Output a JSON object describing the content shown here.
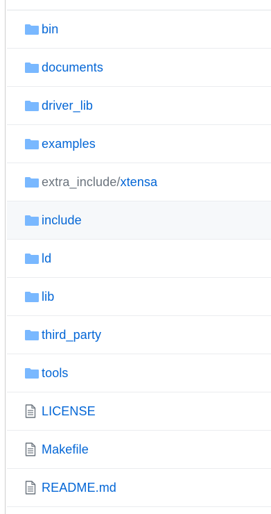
{
  "colors": {
    "link": "#0366d6",
    "folder_icon": "#79b8ff",
    "file_icon": "#6a737d",
    "row_border": "#eaecef",
    "highlight_row": "#f6f8fa"
  },
  "entries": [
    {
      "type": "folder",
      "icon": "folder-icon",
      "name": "bin"
    },
    {
      "type": "folder",
      "icon": "folder-icon",
      "name": "documents"
    },
    {
      "type": "folder",
      "icon": "folder-icon",
      "name": "driver_lib"
    },
    {
      "type": "folder",
      "icon": "folder-icon",
      "name": "examples"
    },
    {
      "type": "folder",
      "icon": "folder-icon",
      "name_prefix": "extra_include/",
      "name_tail": "xtensa"
    },
    {
      "type": "folder",
      "icon": "folder-icon",
      "name": "include",
      "highlighted": true
    },
    {
      "type": "folder",
      "icon": "folder-icon",
      "name": "ld"
    },
    {
      "type": "folder",
      "icon": "folder-icon",
      "name": "lib"
    },
    {
      "type": "folder",
      "icon": "folder-icon",
      "name": "third_party"
    },
    {
      "type": "folder",
      "icon": "folder-icon",
      "name": "tools"
    },
    {
      "type": "file",
      "icon": "file-text-icon",
      "name": "LICENSE"
    },
    {
      "type": "file",
      "icon": "file-text-icon",
      "name": "Makefile"
    },
    {
      "type": "file",
      "icon": "file-text-icon",
      "name": "README.md"
    }
  ]
}
